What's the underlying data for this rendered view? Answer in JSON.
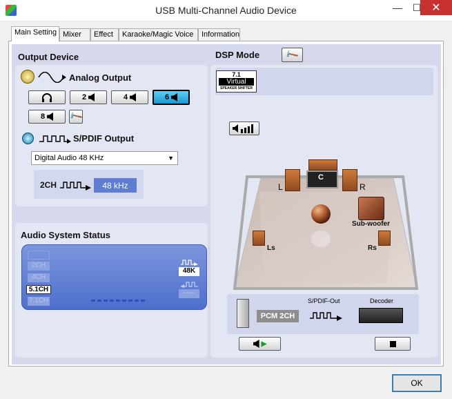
{
  "window": {
    "title": "USB Multi-Channel Audio Device",
    "minimize": "—",
    "maximize": "☐",
    "close": "✕"
  },
  "tabs": [
    {
      "label": "Main Setting"
    },
    {
      "label": "Mixer"
    },
    {
      "label": "Effect"
    },
    {
      "label": "Karaoke/Magic Voice"
    },
    {
      "label": "Information"
    }
  ],
  "output_device": {
    "header": "Output Device",
    "analog_label": "Analog Output",
    "channel_buttons": [
      "2",
      "4",
      "6",
      "8"
    ],
    "selected_channel": "6",
    "spdif_label": "S/PDIF Output",
    "spdif_select_value": "Digital Audio 48 KHz",
    "spdif_chain_label": "2CH",
    "spdif_rate": "48 kHz"
  },
  "audio_status": {
    "header": "Audio System Status",
    "channels": [
      "2CH",
      "4CH",
      "5.1CH",
      "7.1CH"
    ],
    "active_channel": "5.1CH",
    "sample_rate": "48K",
    "rate_blank": "-----"
  },
  "dsp": {
    "header": "DSP Mode",
    "virtual_top": "7.1",
    "virtual_mid": "Virtual",
    "virtual_bottom": "SPEAKER SHIFTER",
    "speakers": {
      "left": "L",
      "center": "C",
      "right": "R",
      "subwoofer": "Sub-woofer",
      "left_surround": "Ls",
      "right_surround": "Rs"
    },
    "pcm_label": "PCM 2CH",
    "spdif_out_label": "S/PDIF-Out",
    "decoder_label": "Decoder"
  },
  "footer": {
    "ok_label": "OK"
  },
  "colors": {
    "accent": "#2d9fd9",
    "panel_bg": "#d6d9ec",
    "status_bg": "#5f7ed1",
    "close_red": "#c7312f"
  }
}
